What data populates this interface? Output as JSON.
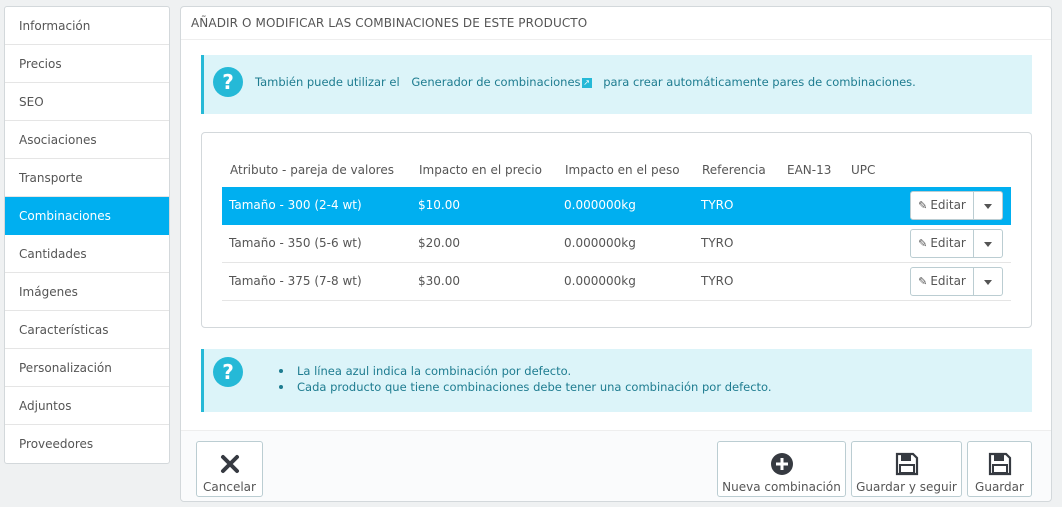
{
  "sidebar": {
    "items": [
      {
        "label": "Información"
      },
      {
        "label": "Precios"
      },
      {
        "label": "SEO"
      },
      {
        "label": "Asociaciones"
      },
      {
        "label": "Transporte"
      },
      {
        "label": "Combinaciones"
      },
      {
        "label": "Cantidades"
      },
      {
        "label": "Imágenes"
      },
      {
        "label": "Características"
      },
      {
        "label": "Personalización"
      },
      {
        "label": "Adjuntos"
      },
      {
        "label": "Proveedores"
      }
    ],
    "active": "Combinaciones"
  },
  "panel": {
    "title": "AÑADIR O MODIFICAR LAS COMBINACIONES DE ESTE PRODUCTO"
  },
  "info_alert": {
    "icon": "question-icon",
    "text_before": "También puede utilizar el",
    "link": "Generador de combinaciones",
    "text_after": "para crear automáticamente pares de combinaciones."
  },
  "table": {
    "headers": [
      "Atributo - pareja de valores",
      "Impacto en el precio",
      "Impacto en el peso",
      "Referencia",
      "EAN-13",
      "UPC"
    ],
    "rows": [
      {
        "attribute": "Tamaño - 300 (2-4 wt)",
        "price": "$10.00",
        "weight": "0.000000kg",
        "reference": "TYRO",
        "ean13": "",
        "upc": "",
        "default": true
      },
      {
        "attribute": "Tamaño - 350 (5-6 wt)",
        "price": "$20.00",
        "weight": "0.000000kg",
        "reference": "TYRO",
        "ean13": "",
        "upc": "",
        "default": false
      },
      {
        "attribute": "Tamaño - 375 (7-8 wt)",
        "price": "$30.00",
        "weight": "0.000000kg",
        "reference": "TYRO",
        "ean13": "",
        "upc": "",
        "default": false
      }
    ],
    "edit_label": "Editar",
    "highlight_color": "#00aff0"
  },
  "help_alert": {
    "icon": "question-icon",
    "items": [
      "La línea azul indica la combinación por defecto.",
      "Cada producto que tiene combinaciones debe tener una combinación por defecto."
    ]
  },
  "footer": {
    "cancel_label": "Cancelar",
    "new_label": "Nueva combinación",
    "save_stay_label": "Guardar y seguir",
    "save_label": "Guardar"
  },
  "colors": {
    "accent": "#00aff0",
    "info_bg": "#dcf4f9",
    "info_border": "#25b9d7"
  }
}
